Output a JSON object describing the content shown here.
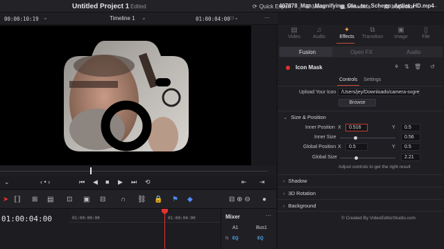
{
  "app": {
    "project_title": "Untitled Project 1",
    "status": "Edited",
    "quick_export": "Quick Export",
    "mixer": "Mixer",
    "metadata": "Metadata",
    "inspector": "Inspector"
  },
  "viewer": {
    "source_tc": "00:00:10:19",
    "timeline_name": "Timeline 1",
    "record_tc": "01:00:04:00",
    "clip_name": "407878_Man_Magnifying_Gla...ter_Schepp_Artlist_HD.mp4"
  },
  "timeline": {
    "timecode": "01:00:04:00",
    "ruler_start": "01:00:00:00",
    "ruler_mid": "01:00:04:00"
  },
  "mixer_panel": {
    "title": "Mixer",
    "ch1": "A1",
    "ch2": "Bus1",
    "fx": "fx",
    "eq": "EQ"
  },
  "inspector": {
    "tabs": [
      {
        "label": "Video",
        "icon": "film-icon"
      },
      {
        "label": "Audio",
        "icon": "music-icon"
      },
      {
        "label": "Effects",
        "icon": "magic-wand-icon"
      },
      {
        "label": "Transition",
        "icon": "transition-icon"
      },
      {
        "label": "Image",
        "icon": "image-icon"
      },
      {
        "label": "File",
        "icon": "file-icon"
      }
    ],
    "active_tab": "Effects",
    "subtabs": [
      "Fusion",
      "Open FX",
      "Audio"
    ],
    "effect_name": "Icon Mask",
    "control_tabs": [
      "Controls",
      "Settings"
    ],
    "upload_label": "Upload Your Icon",
    "upload_path": "/Users/jey/Downloads/camera-svgre",
    "browse": "Browse",
    "size_position": "Size & Position",
    "inner_position_label": "Inner Position",
    "inner_position_x": "0.516",
    "inner_position_y": "0.5",
    "inner_size_label": "Inner Size",
    "inner_size": "0.56",
    "global_position_label": "Global Position",
    "global_position_x": "0.5",
    "global_position_y": "0.5",
    "global_size_label": "Global Size",
    "global_size": "2.21",
    "x": "X",
    "y": "Y",
    "hint": "Adjust controls to get the right result",
    "sections": [
      "Shadow",
      "3D Rotation",
      "Background"
    ],
    "credit": "© Created By VideoEditorStudio.com"
  },
  "colors": {
    "accent_red": "#e5322f",
    "accent_orange": "#f0a050",
    "accent_blue": "#4fb0ff"
  }
}
